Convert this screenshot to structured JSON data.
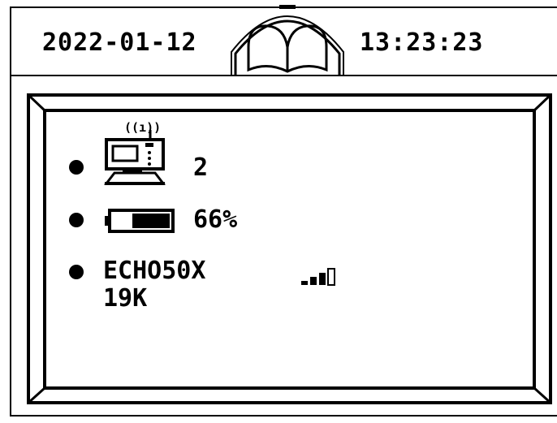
{
  "header": {
    "date": "2022-01-12",
    "time": "13:23:23",
    "logo_icon": "open-book-icon"
  },
  "status": {
    "device": {
      "icon": "wireless-terminal-icon",
      "count": "2"
    },
    "battery": {
      "icon": "battery-icon",
      "percent_text": "66%",
      "level": 0.66
    },
    "echo": {
      "label": "ECHO50X 19K",
      "signal_icon": "signal-strength-icon",
      "signal_bars_filled": 3,
      "signal_bars_total": 4
    }
  },
  "colors": {
    "foreground": "#000000",
    "background": "#ffffff"
  }
}
